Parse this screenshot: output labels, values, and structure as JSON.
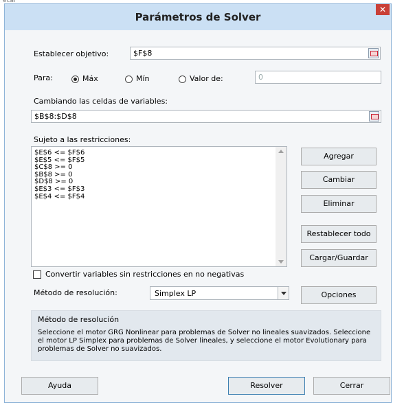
{
  "backdrop": {
    "text": "ecar"
  },
  "dialog": {
    "title": "Parámetros de Solver",
    "close_label": "✕"
  },
  "objective": {
    "label": "Establecer objetivo:",
    "value": "$F$8"
  },
  "to": {
    "label": "Para:",
    "options": [
      "Máx",
      "Mín",
      "Valor de:"
    ],
    "selected": "Máx",
    "value_field": "0"
  },
  "variables": {
    "label": "Cambiando las celdas de variables:",
    "value": "$B$8:$D$8"
  },
  "constraints": {
    "label": "Sujeto a las restricciones:",
    "items": [
      "$E$6 <= $F$6",
      "$E$5 <= $F$5",
      "$C$8 >= 0",
      "$B$8 >= 0",
      "$D$8 >= 0",
      "$E$3 <= $F$3",
      "$E$4 <= $F$4"
    ]
  },
  "buttons": {
    "add": "Agregar",
    "change": "Cambiar",
    "delete": "Eliminar",
    "reset": "Restablecer todo",
    "load_save": "Cargar/Guardar",
    "options": "Opciones",
    "help": "Ayuda",
    "solve": "Resolver",
    "close": "Cerrar"
  },
  "nonneg": {
    "label": "Convertir variables sin restricciones en no negativas",
    "checked": false
  },
  "method": {
    "label": "Método de resolución:",
    "selected": "Simplex LP"
  },
  "method_info": {
    "title": "Método de resolución",
    "text": "Seleccione el motor GRG Nonlinear para problemas de Solver no lineales suavizados. Seleccione el motor LP Simplex para problemas de Solver lineales, y seleccione el motor Evolutionary para problemas de Solver no suavizados."
  }
}
